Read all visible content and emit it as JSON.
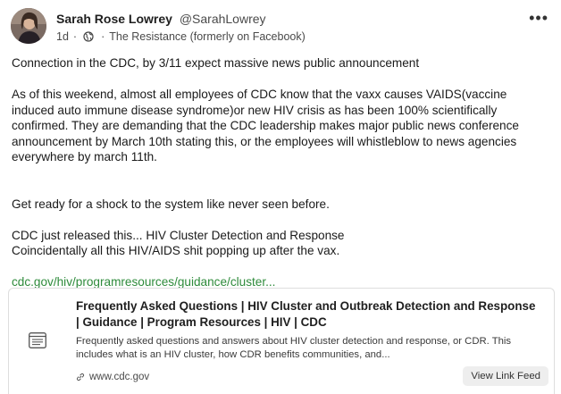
{
  "author": {
    "name": "Sarah Rose Lowrey",
    "handle": "@SarahLowrey",
    "age": "1d",
    "group": "The Resistance (formerly on Facebook)"
  },
  "menu": {
    "more_label": "•••"
  },
  "post": {
    "p1": "Connection in the CDC, by 3/11 expect massive news public announcement",
    "p2": "As of this weekend, almost all employees of CDC know that the vaxx causes VAIDS(vaccine induced auto immune disease syndrome)or new HIV crisis as has been 100% scientifically confirmed. They are demanding that the CDC leadership makes major public news conference announcement by March 10th stating this, or the employees will whistleblow to news agencies everywhere by march 11th.",
    "p3": "Get ready for a shock to the system like never seen before.",
    "p4a": "CDC just released this... HIV Cluster Detection and Response",
    "p4b": "Coincidentally all this HIV/AIDS shit popping up after the vax.",
    "link_text": "cdc.gov/hiv/programresources/guidance/cluster..."
  },
  "card": {
    "title": "Frequently Asked Questions | HIV Cluster and Outbreak Detection and Response | Guidance | Program Resources | HIV | CDC",
    "description": "Frequently asked questions and answers about HIV cluster detection and response, or CDR. This includes what is an HIV cluster, how CDR benefits communities, and...",
    "domain": "www.cdc.gov",
    "button_label": "View Link Feed"
  },
  "icons": {
    "avatar": "profile-photo",
    "visibility": "globe-icon",
    "more": "more-options-icon",
    "card": "article-icon",
    "link": "link-icon"
  },
  "colors": {
    "link": "#2e8b3b",
    "card_border": "#dedede",
    "button_bg": "#eeeeee"
  }
}
